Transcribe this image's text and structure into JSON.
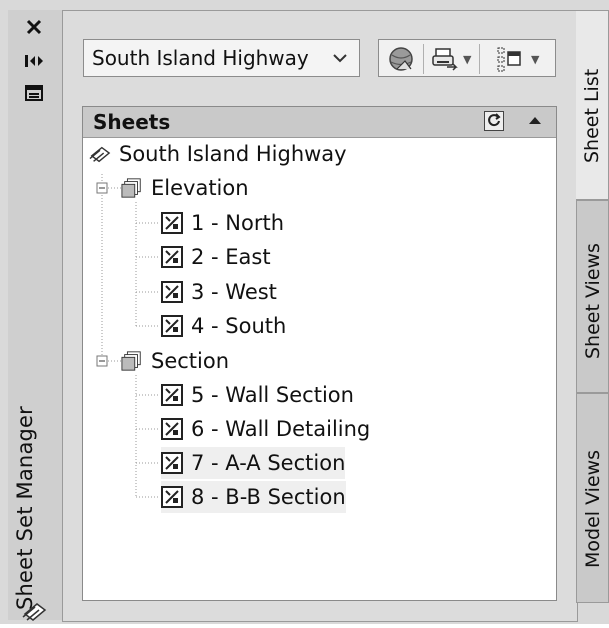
{
  "palette": {
    "window_bg": "#d9d9d9",
    "panel_bg": "#ffffff",
    "header_bg": "#c9c9c9",
    "highlight_row": "#efefef",
    "text": "#111111"
  },
  "left_strip": {
    "title": "Sheet Set Manager",
    "close_icon": "close-icon",
    "autohide_icon": "auto-hide-icon",
    "properties_icon": "properties-icon",
    "logo_icon": "sheet-set-logo-icon"
  },
  "toolbar": {
    "sheet_set_select": "South Island Highway",
    "buttons": [
      {
        "icon": "publish-globe-icon"
      },
      {
        "icon": "plot-publish-icon",
        "has_dropdown": true
      },
      {
        "icon": "sheet-selections-icon",
        "has_dropdown": true
      }
    ]
  },
  "sheets_panel": {
    "title": "Sheets",
    "refresh_icon": "refresh-icon",
    "collapse_icon": "collapse-up-icon",
    "root": "South Island Highway",
    "subsets": [
      {
        "name": "Elevation",
        "sheets": [
          "1 - North",
          "2 - East",
          "3 - West",
          "4 - South"
        ]
      },
      {
        "name": "Section",
        "sheets": [
          "5 - Wall Section",
          "6 - Wall Detailing",
          "7 - A-A Section",
          "8 - B-B Section"
        ]
      }
    ]
  },
  "tabs": [
    {
      "label": "Sheet List",
      "active": true
    },
    {
      "label": "Sheet Views",
      "active": false
    },
    {
      "label": "Model Views",
      "active": false
    }
  ]
}
